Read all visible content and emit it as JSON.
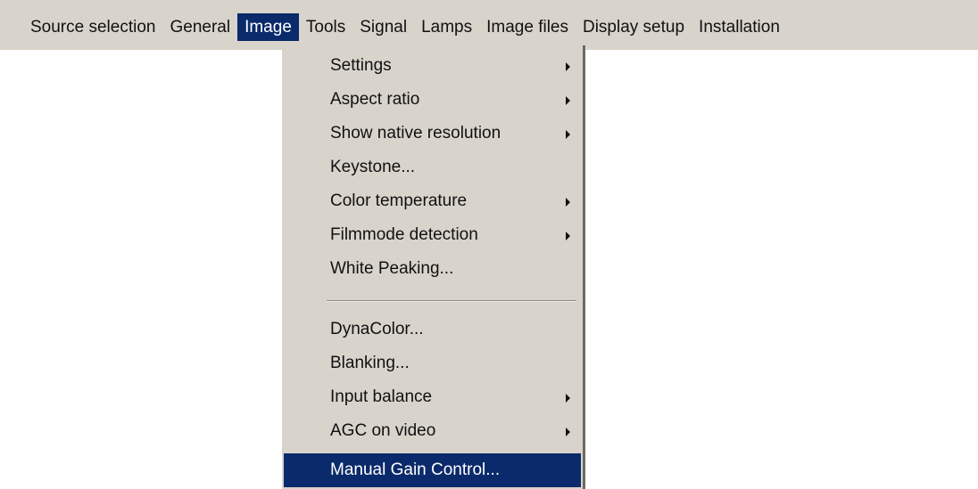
{
  "menubar": {
    "items": [
      {
        "label": "Source selection"
      },
      {
        "label": "General"
      },
      {
        "label": "Image"
      },
      {
        "label": "Tools"
      },
      {
        "label": "Signal"
      },
      {
        "label": "Lamps"
      },
      {
        "label": "Image files"
      },
      {
        "label": "Display setup"
      },
      {
        "label": "Installation"
      }
    ],
    "active": "Image"
  },
  "image_menu": {
    "items": [
      {
        "label": "Settings",
        "submenu": true
      },
      {
        "label": "Aspect ratio",
        "submenu": true
      },
      {
        "label": "Show native resolution",
        "submenu": true
      },
      {
        "label": "Keystone...",
        "submenu": false
      },
      {
        "label": "Color temperature",
        "submenu": true
      },
      {
        "label": "Filmmode detection",
        "submenu": true
      },
      {
        "label": "White Peaking...",
        "submenu": false
      },
      {
        "label": "DynaColor...",
        "submenu": false
      },
      {
        "label": "Blanking...",
        "submenu": false
      },
      {
        "label": "Input balance",
        "submenu": true
      },
      {
        "label": "AGC on video",
        "submenu": true
      },
      {
        "label": "Manual Gain Control...",
        "submenu": false
      }
    ],
    "selected": "Manual Gain Control..."
  },
  "colors": {
    "menu_background": "#d8d4cc",
    "highlight": "#0b2a6b",
    "highlight_text": "#ffffff"
  },
  "icons": {
    "submenu_indicator": "triangle-right-icon"
  }
}
